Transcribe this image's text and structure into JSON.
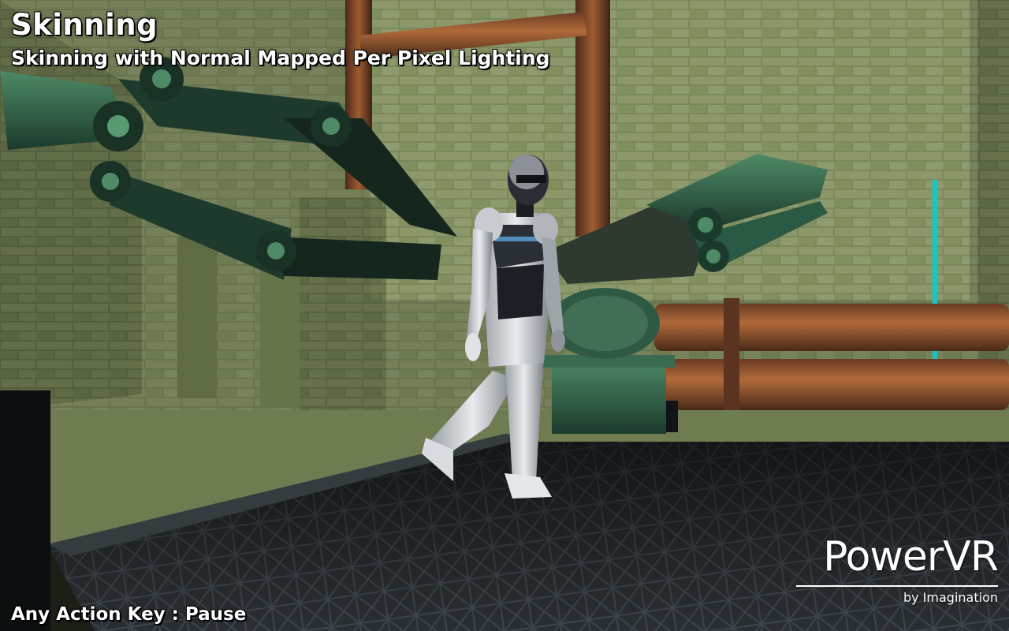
{
  "demo": {
    "title": "Skinning",
    "subtitle": "Skinning with Normal Mapped Per Pixel Lighting",
    "controls_hint": "Any Action Key : Pause"
  },
  "logo": {
    "brand": "PowerVR",
    "tagline": "by Imagination"
  },
  "colors": {
    "accent_cyan": "#14c8c8",
    "rust": "#8a4a26",
    "machine_green": "#2f6a4e",
    "wall_green": "#7d8a5c",
    "floor_dark": "#2d3338"
  }
}
